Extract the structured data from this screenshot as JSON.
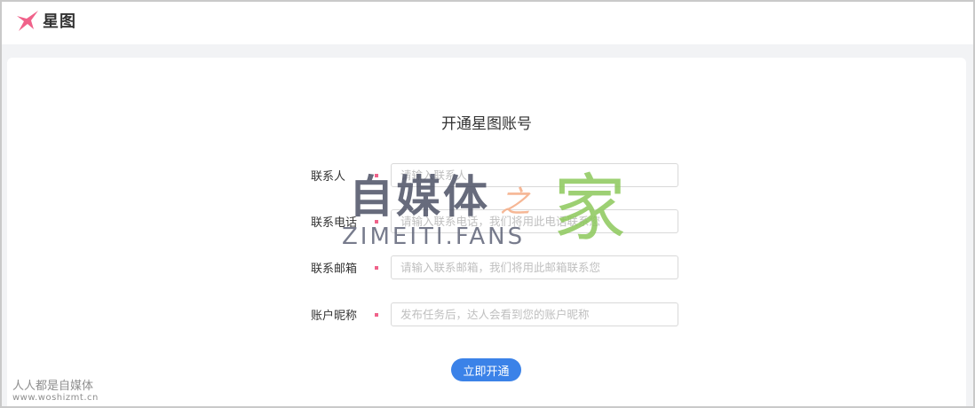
{
  "header": {
    "logo_icon": "star-icon",
    "logo_text": "星图",
    "accent_color": "#f0628a"
  },
  "form": {
    "title": "开通星图账号",
    "fields": [
      {
        "label": "联系人",
        "placeholder": "请输入联系人",
        "value": "",
        "required": true
      },
      {
        "label": "联系电话",
        "placeholder": "请输入联系电话，我们将用此电话联系您",
        "value": "",
        "required": true
      },
      {
        "label": "联系邮箱",
        "placeholder": "请输入联系邮箱，我们将用此邮箱联系您",
        "value": "",
        "required": true
      },
      {
        "label": "账户昵称",
        "placeholder": "发布任务后，达人会看到您的账户昵称",
        "value": "",
        "required": true
      }
    ],
    "submit_label": "立即开通",
    "submit_color": "#3b82e8"
  },
  "watermarks": {
    "center_main": "自媒体",
    "center_zhi": "之",
    "center_jia": "家",
    "center_domain": "ZIMEITI.FANS",
    "corner_line1": "人人都是自媒体",
    "corner_line2": "www.woshizmt.cn"
  }
}
